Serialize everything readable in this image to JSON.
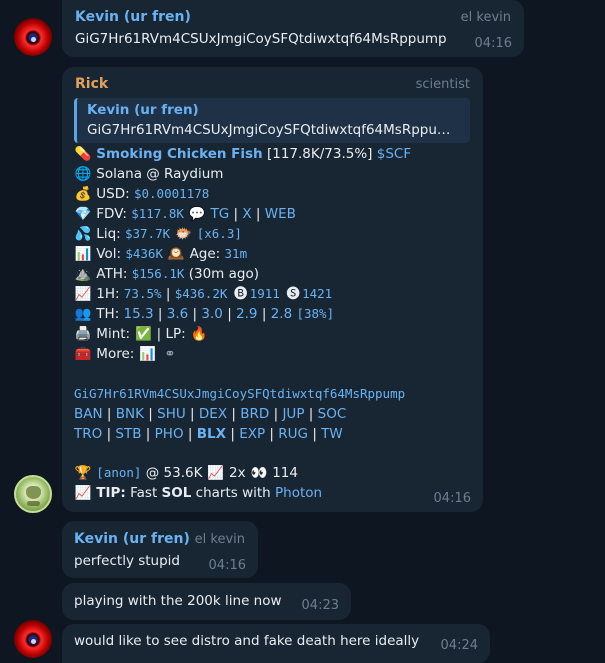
{
  "messages": {
    "m1": {
      "author": "Kevin (ur fren)",
      "role": "el kevin",
      "text": "GiG7Hr61RVm4CSUxJmgiCoySFQtdiwxtqf64MsRppump",
      "time": "04:16"
    },
    "m2": {
      "author": "Rick",
      "role": "scientist",
      "reply_author": "Kevin (ur fren)",
      "reply_text": "GiG7Hr61RVm4CSUxJmgiCoySFQtdiwxtqf64MsRppu…",
      "token_name": "Smoking Chicken Fish",
      "token_stats": " [117.8K/73.5%] ",
      "ticker": "$SCF",
      "chain": "Solana @ Raydium",
      "usd_label": "USD: ",
      "usd_value": "$0.0001178",
      "fdv_label": "FDV: ",
      "fdv_value": "$117.8K",
      "tg": "TG",
      "x": "X",
      "web": "WEB",
      "liq_label": "Liq: ",
      "liq_value": "$37.7K",
      "liq_mult": "[x6.3]",
      "vol_label": "Vol: ",
      "vol_value": "$436K",
      "age_label": " Age: ",
      "age_value": "31m",
      "ath_label": "ATH: ",
      "ath_value": "$156.1K",
      "ath_note": " (30m ago)",
      "h1_label": "1H: ",
      "h1_pct": "73.5%",
      "h1_vol": "$436.2K",
      "h1_buys": "1911",
      "h1_sells": "1421",
      "th_label": "TH: ",
      "th_values": [
        "15.3",
        "3.6",
        "3.0",
        "2.9",
        "2.8"
      ],
      "th_total": "[38%]",
      "mint_label": "Mint: ",
      "lp_label": " | LP: ",
      "more_label": "More: ",
      "contract": "GiG7Hr61RVm4CSUxJmgiCoySFQtdiwxtqf64MsRppump",
      "links_row1": [
        "BAN",
        "BNK",
        "SHU",
        "DEX",
        "BRD",
        "JUP",
        "SOC"
      ],
      "links_row2": [
        "TRO",
        "STB",
        "PHO",
        "BLX",
        "EXP",
        "RUG",
        "TW"
      ],
      "caller": "[anon]",
      "caller_mc": " @ 53.6K ",
      "caller_mult": " 2x ",
      "caller_views": " 114",
      "tip_label": "TIP:",
      "tip_text1": " Fast ",
      "tip_sol": "SOL",
      "tip_text2": " charts with ",
      "tip_link": "Photon",
      "time": "04:16"
    },
    "m3": {
      "author": "Kevin (ur fren)",
      "role": "el kevin",
      "text": "perfectly stupid",
      "time": "04:16"
    },
    "m4": {
      "text": "playing with the 200k line now",
      "time": "04:23"
    },
    "m5": {
      "text": "would like to see distro and fake death here ideally",
      "time": "04:24"
    }
  },
  "colors": {
    "background": "#0e1621",
    "bubble": "#182533",
    "kevin_name": "#6ab2f2",
    "rick_name": "#e4a05a",
    "link": "#6ab2f2",
    "meta": "#6d7f8f"
  },
  "icons": {
    "kevin_avatar": "red-orb-avatar",
    "rick_avatar": "green-face-avatar"
  }
}
